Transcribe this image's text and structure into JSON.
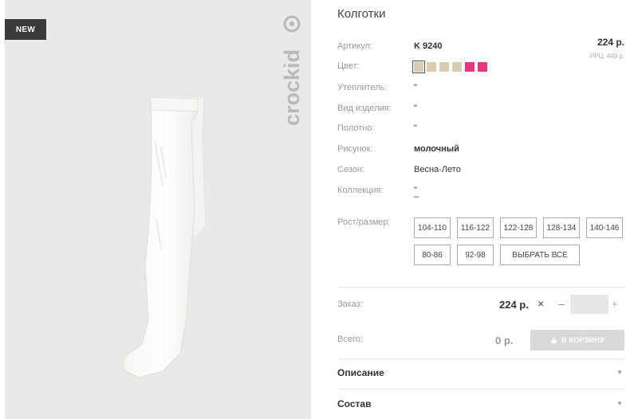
{
  "photo": {
    "badge": "NEW",
    "brand": "crockid"
  },
  "product": {
    "title": "Колготки",
    "price": "224 р.",
    "rrp": "РРЦ: 449 р.",
    "specs": [
      {
        "label": "Артикул:",
        "value": "K 9240"
      },
      {
        "label": "Цвет:",
        "value": ""
      },
      {
        "label": "Утеплитель:",
        "value": "\""
      },
      {
        "label": "Вид изделия:",
        "value": "\""
      },
      {
        "label": "Полотно:",
        "value": "\""
      },
      {
        "label": "Рисунок:",
        "value": "молочный"
      },
      {
        "label": "Сезон:",
        "value": "Весна-Лето"
      },
      {
        "label": "Коллекция:",
        "value": "\""
      }
    ],
    "collection_extra": "–",
    "swatches": [
      "#d8ccb1",
      "#d8ccb1",
      "#d8ccb1",
      "#d8ccb1",
      "#e8377f",
      "#e8377f"
    ],
    "size_label": "Рост/размер:",
    "sizes": [
      "104-110",
      "116-122",
      "122-128",
      "128-134",
      "140-146",
      "80-86",
      "92-98"
    ],
    "select_all": "ВЫБРАТЬ ВСЕ"
  },
  "order": {
    "label": "Заказ:",
    "total": "224 р.",
    "remove_icon": "×",
    "minus": "–",
    "plus": "+",
    "qty_value": ""
  },
  "summary": {
    "label": "Всего:",
    "sum": "0 р.",
    "cart_button": "В КОРЗИНУ"
  },
  "accordion": {
    "description": "Описание",
    "composition": "Состав"
  }
}
